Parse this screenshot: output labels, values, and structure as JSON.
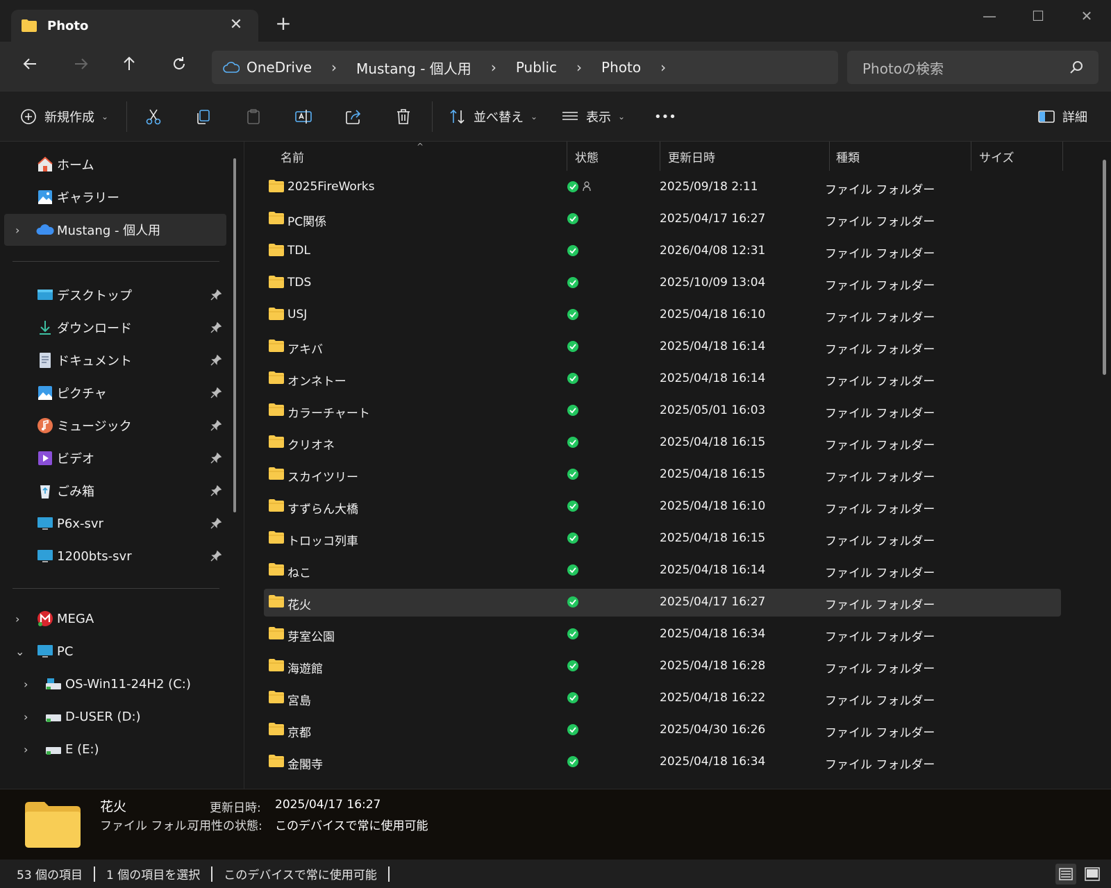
{
  "window": {
    "tab_title": "Photo",
    "new_tab": "+",
    "close_tab": "✕"
  },
  "nav": {
    "breadcrumbs": [
      "OneDrive",
      "Mustang - 個人用",
      "Public",
      "Photo"
    ],
    "search_placeholder": "Photoの検索"
  },
  "toolbar": {
    "new_label": "新規作成",
    "sort_label": "並べ替え",
    "view_label": "表示",
    "more_label": "•••",
    "details_label": "詳細"
  },
  "sidebar": {
    "top": [
      {
        "label": "ホーム",
        "icon": "home-icon"
      },
      {
        "label": "ギャラリー",
        "icon": "gallery-icon"
      },
      {
        "label": "Mustang - 個人用",
        "icon": "onedrive-cloud-icon"
      }
    ],
    "pinned": [
      {
        "label": "デスクトップ",
        "icon": "desktop-icon"
      },
      {
        "label": "ダウンロード",
        "icon": "download-icon"
      },
      {
        "label": "ドキュメント",
        "icon": "document-icon"
      },
      {
        "label": "ピクチャ",
        "icon": "pictures-icon"
      },
      {
        "label": "ミュージック",
        "icon": "music-icon"
      },
      {
        "label": "ビデオ",
        "icon": "video-icon"
      },
      {
        "label": "ごみ箱",
        "icon": "recycle-bin-icon"
      },
      {
        "label": "P6x-svr",
        "icon": "monitor-icon"
      },
      {
        "label": "1200bts-svr",
        "icon": "monitor-icon"
      }
    ],
    "devices": [
      {
        "label": "MEGA",
        "icon": "mega-icon"
      },
      {
        "label": "PC",
        "icon": "pc-icon"
      },
      {
        "label": "OS-Win11-24H2 (C:)",
        "icon": "drive-icon"
      },
      {
        "label": "D-USER (D:)",
        "icon": "drive-icon"
      },
      {
        "label": "E (E:)",
        "icon": "drive-icon"
      }
    ]
  },
  "columns": {
    "name": "名前",
    "status": "状態",
    "modified": "更新日時",
    "type": "種類",
    "size": "サイズ"
  },
  "files": [
    {
      "name": "2025FireWorks",
      "date": "2025/09/18 2:11",
      "type": "ファイル フォルダー",
      "shared": true
    },
    {
      "name": "PC関係",
      "date": "2025/04/17 16:27",
      "type": "ファイル フォルダー"
    },
    {
      "name": "TDL",
      "date": "2026/04/08 12:31",
      "type": "ファイル フォルダー"
    },
    {
      "name": "TDS",
      "date": "2025/10/09 13:04",
      "type": "ファイル フォルダー"
    },
    {
      "name": "USJ",
      "date": "2025/04/18 16:10",
      "type": "ファイル フォルダー"
    },
    {
      "name": "アキバ",
      "date": "2025/04/18 16:14",
      "type": "ファイル フォルダー"
    },
    {
      "name": "オンネトー",
      "date": "2025/04/18 16:14",
      "type": "ファイル フォルダー"
    },
    {
      "name": "カラーチャート",
      "date": "2025/05/01 16:03",
      "type": "ファイル フォルダー"
    },
    {
      "name": "クリオネ",
      "date": "2025/04/18 16:15",
      "type": "ファイル フォルダー"
    },
    {
      "name": "スカイツリー",
      "date": "2025/04/18 16:15",
      "type": "ファイル フォルダー"
    },
    {
      "name": "すずらん大橋",
      "date": "2025/04/18 16:10",
      "type": "ファイル フォルダー"
    },
    {
      "name": "トロッコ列車",
      "date": "2025/04/18 16:15",
      "type": "ファイル フォルダー"
    },
    {
      "name": "ねこ",
      "date": "2025/04/18 16:14",
      "type": "ファイル フォルダー"
    },
    {
      "name": "花火",
      "date": "2025/04/17 16:27",
      "type": "ファイル フォルダー",
      "selected": true
    },
    {
      "name": "芽室公園",
      "date": "2025/04/18 16:34",
      "type": "ファイル フォルダー"
    },
    {
      "name": "海遊館",
      "date": "2025/04/18 16:28",
      "type": "ファイル フォルダー"
    },
    {
      "name": "宮島",
      "date": "2025/04/18 16:22",
      "type": "ファイル フォルダー"
    },
    {
      "name": "京都",
      "date": "2025/04/30 16:26",
      "type": "ファイル フォルダー"
    },
    {
      "name": "金閣寺",
      "date": "2025/04/18 16:34",
      "type": "ファイル フォルダー"
    }
  ],
  "details": {
    "name": "花火",
    "type": "ファイル フォル...",
    "modified_label": "更新日時:",
    "modified_value": "2025/04/17 16:27",
    "availability_label": "可用性の状態:",
    "availability_value": "このデバイスで常に使用可能"
  },
  "status": {
    "count": "53 個の項目",
    "selected": "1 個の項目を選択",
    "availability": "このデバイスで常に使用可能"
  },
  "colors": {
    "folder": "#f8c94a",
    "sync_ok": "#22c55e",
    "background": "#191919"
  }
}
